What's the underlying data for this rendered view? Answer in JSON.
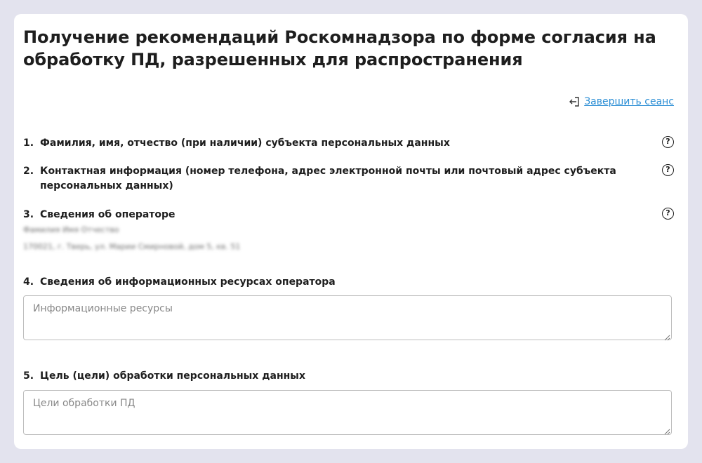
{
  "page": {
    "title": "Получение рекомендаций Роскомнадзора по форме согласия на обработку ПД, разрешенных для распространения"
  },
  "session": {
    "logout_label": "Завершить сеанс",
    "logout_icon": "logout-icon"
  },
  "form": {
    "items": [
      {
        "number": "1.",
        "label": "Фамилия, имя, отчество (при наличии) субъекта персональных данных",
        "help_icon": "question-circle-icon"
      },
      {
        "number": "2.",
        "label": "Контактная информация (номер телефона, адрес электронной почты или почтовый адрес субъекта персональных данных)",
        "help_icon": "question-circle-icon"
      },
      {
        "number": "3.",
        "label": "Сведения об операторе",
        "help_icon": "question-circle-icon"
      },
      {
        "number": "4.",
        "label": "Сведения об информационных ресурсах оператора"
      },
      {
        "number": "5.",
        "label": "Цель (цели) обработки персональных данных"
      }
    ],
    "operator": {
      "name": "Фамилия Имя Отчество",
      "address": "170021, г. Тверь, ул. Марии Смирновой, дом 5, кв. 51"
    },
    "resources_input": {
      "placeholder": "Информационные ресурсы",
      "value": ""
    },
    "purpose_input": {
      "placeholder": "Цели обработки ПД",
      "value": ""
    }
  },
  "colors": {
    "background": "#e3e3ee",
    "card": "#ffffff",
    "link": "#2d8fd5",
    "text": "#1e1e1e",
    "input_border": "#bdbdbd"
  }
}
